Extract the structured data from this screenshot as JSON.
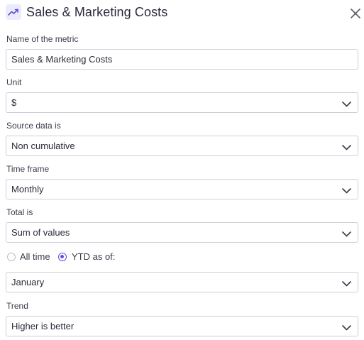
{
  "header": {
    "title": "Sales & Marketing Costs",
    "icon": "trend-up-icon",
    "close_icon": "close-icon",
    "accent": "#5b4fe0"
  },
  "form": {
    "name": {
      "label": "Name of the metric",
      "value": "Sales & Marketing Costs"
    },
    "unit": {
      "label": "Unit",
      "value": "$"
    },
    "source": {
      "label": "Source data is",
      "value": "Non cumulative"
    },
    "timeframe": {
      "label": "Time frame",
      "value": "Monthly"
    },
    "total": {
      "label": "Total is",
      "value": "Sum of values"
    },
    "period": {
      "options": [
        {
          "label": "All time",
          "selected": false
        },
        {
          "label": "YTD as of:",
          "selected": true
        }
      ],
      "value": "January"
    },
    "trend": {
      "label": "Trend",
      "value": "Higher is better"
    }
  }
}
